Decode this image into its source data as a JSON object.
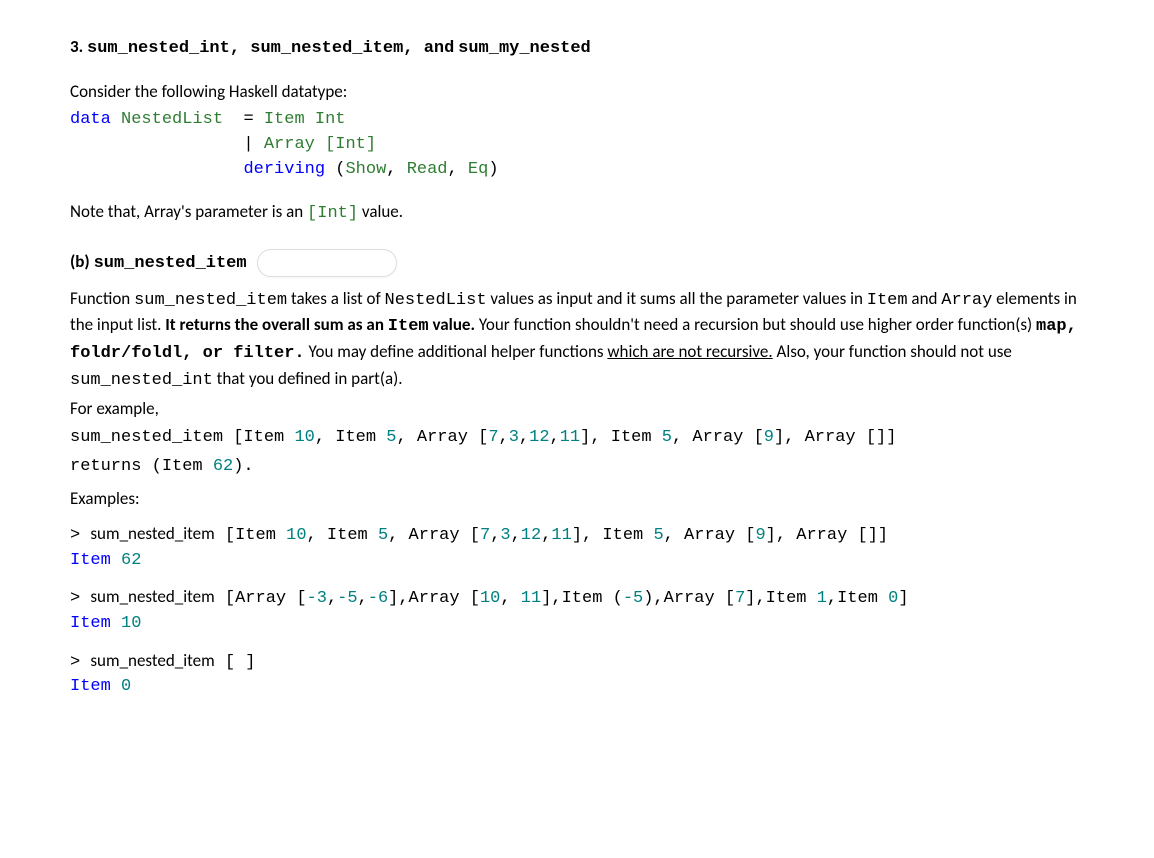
{
  "heading": {
    "number": "3.",
    "fn1": "sum_nested_int",
    "fn2": "sum_nested_item",
    "and": "and",
    "fn3": "sum_my_nested"
  },
  "intro": "Consider the following Haskell datatype:",
  "datatype": {
    "l1_kw": "data",
    "l1_name": "NestedList",
    "l1_eq": "  = ",
    "l1_ctor": "Item",
    "l1_type": "Int",
    "l2_pipe": "                 | ",
    "l2_ctor": "Array",
    "l2_type": "[Int]",
    "l3_prefix": "                 ",
    "l3_kw": "deriving",
    "l3_open": " (",
    "l3_a": "Show",
    "l3_b": "Read",
    "l3_c": "Eq",
    "l3_close": ")"
  },
  "note": {
    "t1": "Note that, Array's parameter is an ",
    "code": "[Int]",
    "t2": " value."
  },
  "sub": {
    "label": "(b)",
    "fn": "sum_nested_item"
  },
  "desc": {
    "p1a": "Function ",
    "p1b": "sum_nested_item",
    "p1c": " takes a list of ",
    "p1d": "NestedList",
    "p1e": " values as input and it sums all the parameter values in ",
    "p1f": "Item",
    "p1g": " and ",
    "p1h": "Array",
    "p1i": " elements in the input list. ",
    "p1j": "It returns the overall sum as an ",
    "p1k": "Item",
    "p1l": " value.",
    "p2a": "Your function shouldn't need a recursion but should use higher order function(s) ",
    "p2b": "map, foldr/foldl, or filter.",
    "p2c": " You may define additional helper functions ",
    "p2d": "which are not recursive.",
    "p2e": " Also, your function should not use ",
    "p2f": "sum_nested_int",
    "p2g": " that you defined in part(a).",
    "p3": "For example,",
    "p4a": "sum_nested_item",
    "p4b": " [Item ",
    "p4n1": "10",
    "p4c": ", Item ",
    "p4n2": "5",
    "p4d": ", Array [",
    "p4n3": "7",
    "p4n4": "3",
    "p4n5": "12",
    "p4n6": "11",
    "p4e": "], Item ",
    "p4n7": "5",
    "p4f": ", Array [",
    "p4n8": "9",
    "p4g": "], Array []]",
    "p5a": "returns (Item ",
    "p5n": "62",
    "p5b": ")."
  },
  "exLabel": "Examples:",
  "ex1": {
    "prompt": ">",
    "fn": "sum_nested_item",
    "a": " [Item ",
    "n1": "10",
    "b": ", Item ",
    "n2": "5",
    "c": ", Array [",
    "n3": "7",
    "n4": "3",
    "n5": "12",
    "n6": "11",
    "d": "], Item ",
    "n7": "5",
    "e": ", Array [",
    "n8": "9",
    "f": "], Array []]",
    "res_a": "Item ",
    "res_n": "62"
  },
  "ex2": {
    "prompt": ">",
    "fn": "sum_nested_item",
    "a": " [Array [",
    "n1": "-3",
    "n2": "-5",
    "n3": "-6",
    "b": "],Array [",
    "n4": "10",
    "n5": "11",
    "c": "],Item (",
    "n6": "-5",
    "d": "),Array [",
    "n7": "7",
    "e": "],Item ",
    "n8": "1",
    "f": ",Item ",
    "n9": "0",
    "g": "]",
    "res_a": "Item ",
    "res_n": "10"
  },
  "ex3": {
    "prompt": ">",
    "fn": "sum_nested_item",
    "a": " [ ]",
    "res_a": "Item ",
    "res_n": "0"
  }
}
